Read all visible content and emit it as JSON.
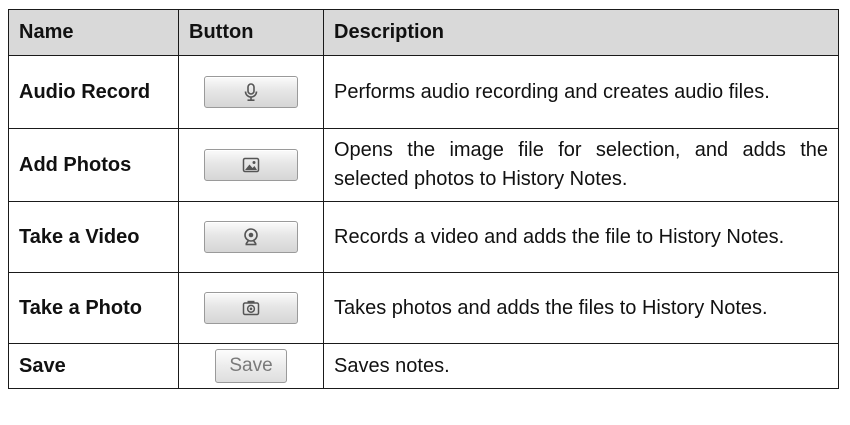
{
  "table": {
    "headers": [
      "Name",
      "Button",
      "Description"
    ],
    "rows": [
      {
        "name": "Audio Record",
        "button_icon": "microphone-icon",
        "description": "Performs audio recording and creates audio files."
      },
      {
        "name": "Add Photos",
        "button_icon": "image-icon",
        "description": "Opens the image file for selection, and adds the selected photos to History Notes."
      },
      {
        "name": "Take a Video",
        "button_icon": "webcam-icon",
        "description": "Records a video and adds the file to History Notes."
      },
      {
        "name": "Take a Photo",
        "button_icon": "camera-icon",
        "description": "Takes photos and adds the files to History Notes."
      },
      {
        "name": "Save",
        "button_label": "Save",
        "description": "Saves notes."
      }
    ]
  },
  "colors": {
    "header_bg": "#d9d9d9",
    "border": "#1a1a1a",
    "button_gray": "#dedede"
  }
}
